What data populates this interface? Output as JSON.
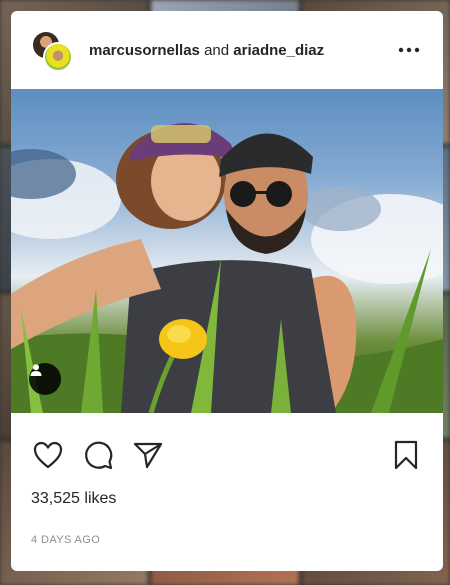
{
  "post": {
    "author_1": "marcusornellas",
    "connector": "and",
    "author_2": "ariadne_diaz",
    "likes_count": "33,525",
    "likes_suffix": "likes",
    "timestamp": "4 DAYS AGO"
  },
  "icons": {
    "more": "more-options-icon",
    "like": "heart-icon",
    "comment": "comment-icon",
    "share": "share-icon",
    "save": "bookmark-icon",
    "user_tag": "user-tag-icon"
  },
  "colors": {
    "text_primary": "#262626",
    "text_secondary": "#8e8e8e",
    "card_bg": "#ffffff"
  }
}
